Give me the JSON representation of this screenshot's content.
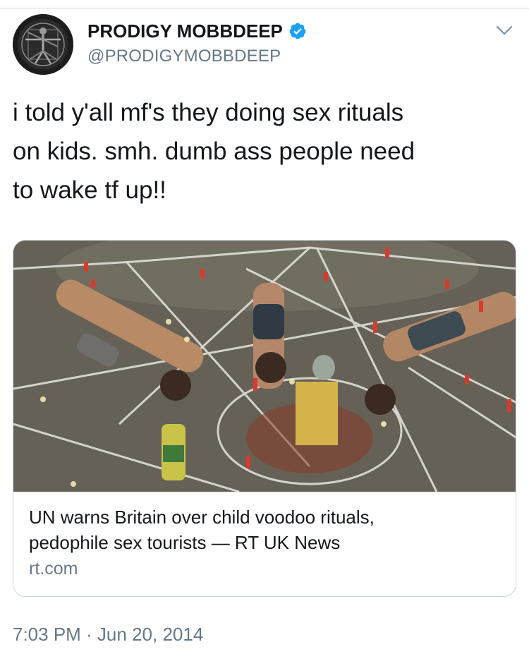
{
  "tweet": {
    "author": {
      "display_name": "PRODIGY MOBBDEEP",
      "handle": "@PRODIGYMOBBDEEP",
      "verified": true,
      "avatar_icon": "vitruvian-figure-avatar"
    },
    "text_lines": [
      "i told y'all mf's they doing sex rituals",
      "on kids. smh. dumb ass people need",
      "to wake tf up!!"
    ],
    "card": {
      "image_icon": "ritual-photo",
      "title_lines": [
        "UN warns Britain over child voodoo rituals,",
        "pedophile sex tourists — RT UK News"
      ],
      "domain": "rt.com"
    },
    "timestamp": "7:03 PM · Jun 20, 2014"
  },
  "colors": {
    "primary_text": "#14171a",
    "secondary_text": "#657786",
    "border": "#ccd6dd",
    "verified_blue": "#1da1f2"
  }
}
